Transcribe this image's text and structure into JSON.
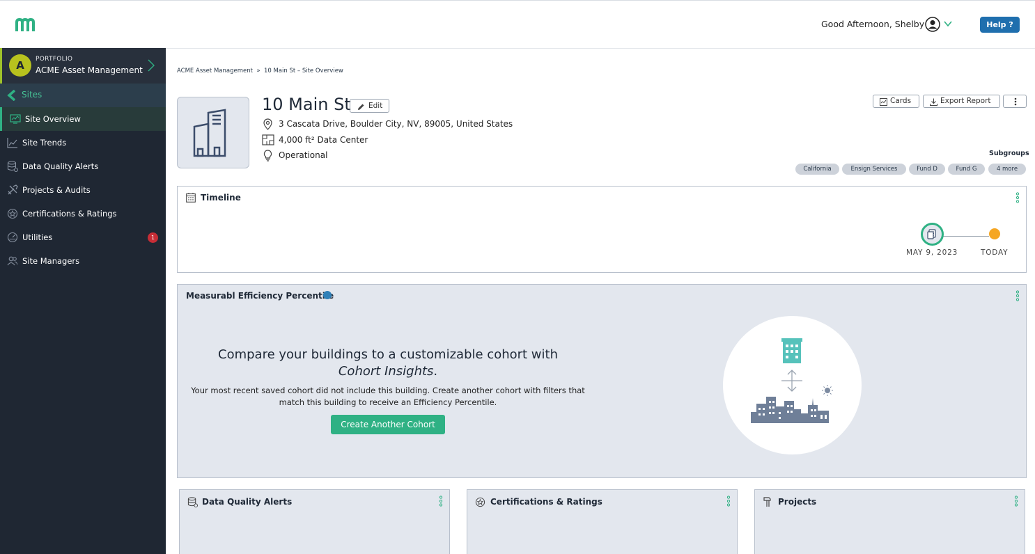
{
  "header": {
    "greeting": "Good Afternoon, Shelby",
    "help_label": "Help ?"
  },
  "sidebar": {
    "portfolio_label": "PORTFOLIO",
    "portfolio_name": "ACME Asset Management",
    "avatar_letter": "A",
    "back_label": "Sites",
    "items": [
      {
        "label": "Site Overview",
        "icon": "chart-monitor-icon",
        "active": true
      },
      {
        "label": "Site Trends",
        "icon": "trend-line-icon"
      },
      {
        "label": "Data Quality Alerts",
        "icon": "database-alert-icon"
      },
      {
        "label": "Projects & Audits",
        "icon": "tools-icon"
      },
      {
        "label": "Certifications & Ratings",
        "icon": "badge-star-icon"
      },
      {
        "label": "Utilities",
        "icon": "gauge-icon",
        "badge": "1"
      },
      {
        "label": "Site Managers",
        "icon": "users-icon"
      }
    ]
  },
  "breadcrumb": {
    "text": "ACME Asset Management  »  10 Main St – Site Overview"
  },
  "site": {
    "title": "10 Main St",
    "edit_label": "Edit",
    "address": "3 Cascata Drive, Boulder City, NV, 89005, United States",
    "area": "4,000 ft² Data Center",
    "status": "Operational"
  },
  "toolbar": {
    "cards_label": "Cards",
    "export_label": "Export Report"
  },
  "subgroups": {
    "label": "Subgroups",
    "chips": [
      "California",
      "Ensign Services",
      "Fund D",
      "Fund G",
      "4 more"
    ]
  },
  "timeline": {
    "title": "Timeline",
    "start_date": "MAY 9, 2023",
    "end_label": "TODAY"
  },
  "efficiency": {
    "title": "Measurabl Efficiency Percentile",
    "heading_prefix": "Compare your buildings to a customizable cohort with",
    "heading_emphasis": "Cohort Insights",
    "heading_suffix": ".",
    "description": "Your most recent saved cohort did not include this building. Create another cohort with filters that match this building to receive an Efficiency Percentile.",
    "button_label": "Create Another Cohort"
  },
  "bottom_cards": {
    "data_quality_title": "Data Quality Alerts",
    "certifications_title": "Certifications & Ratings",
    "projects_title": "Projects"
  },
  "colors": {
    "sidebar_bg": "#1f2733",
    "accent_green": "#2fb184",
    "help_blue": "#1f6fae",
    "timeline_today": "#f5a623",
    "alert_red": "#c62d36"
  }
}
